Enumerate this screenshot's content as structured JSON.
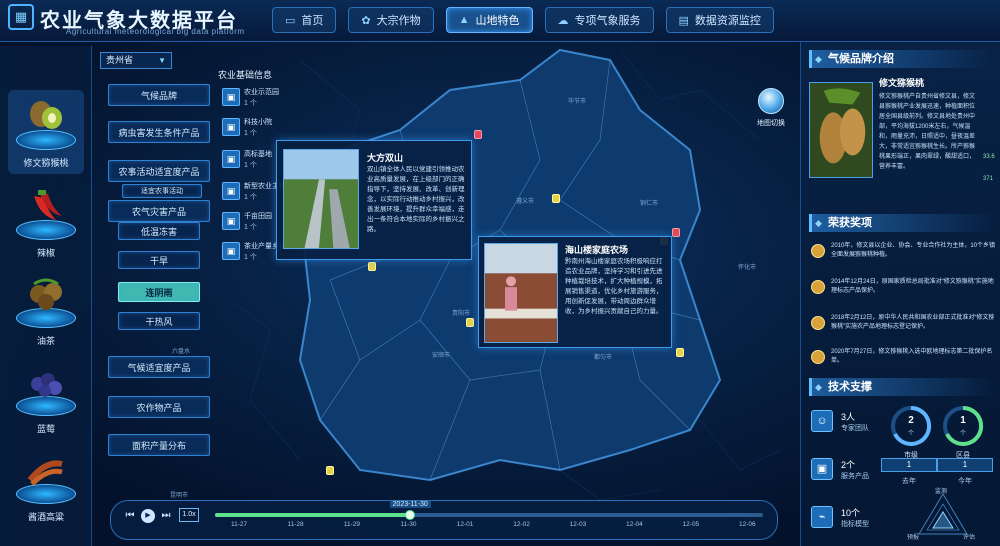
{
  "header": {
    "title": "农业气象大数据平台",
    "subtitle": "Agricultural meteorological big data platform",
    "tabs": [
      {
        "label": "首页",
        "icon": "monitor-icon"
      },
      {
        "label": "大宗作物",
        "icon": "crop-icon"
      },
      {
        "label": "山地特色",
        "icon": "mountain-icon",
        "active": true
      },
      {
        "label": "专项气象服务",
        "icon": "weather-icon"
      },
      {
        "label": "数据资源监控",
        "icon": "database-icon"
      }
    ]
  },
  "crops": [
    {
      "label": "修文猕猴桃",
      "icon": "kiwi-icon",
      "active": true
    },
    {
      "label": "辣椒",
      "icon": "chili-icon"
    },
    {
      "label": "油茶",
      "icon": "oil-tea-icon"
    },
    {
      "label": "蓝莓",
      "icon": "blueberry-icon"
    },
    {
      "label": "酱酒高粱",
      "icon": "sorghum-icon"
    }
  ],
  "province": {
    "selected": "贵州省"
  },
  "controls": {
    "climate_brand": "气候品牌",
    "pest_product": "病虫害发生条件产品",
    "farming_product": "农事活动适宜度产品",
    "farming_small": "适宜农事活动",
    "disaster_product": "农气灾害产品",
    "low_temp": "低温冻害",
    "drought": "干旱",
    "continuous_rain": "连阴雨",
    "dry_hot_wind": "干热风",
    "suitability_product": "气候适宜度产品",
    "yield_product": "农作物产品",
    "yield_distribution": "面积产量分布"
  },
  "info": {
    "title": "农业基础信息",
    "items": [
      {
        "name": "农业示范园",
        "count": "1 个"
      },
      {
        "name": "科技小院",
        "count": "1 个"
      },
      {
        "name": "高标基地",
        "count": "1 个"
      },
      {
        "name": "新型农业主体",
        "count": "1 个"
      },
      {
        "name": "千亩田园",
        "count": "1 个"
      },
      {
        "name": "茶业产量乡镇",
        "count": "1 个"
      }
    ]
  },
  "popups": [
    {
      "title": "大方双山",
      "text": "双山镇全体人民以党建引领推动农业高质量发展，在上级部门的正确指导下，坚持发展、改革、创新理念，以实际行动推动乡村振兴，改善发展环境，提升群众幸福感，走出一条符合本地实际的乡村振兴之路。"
    },
    {
      "title": "海山楼家庭农场",
      "text": "黔南州海山楼家庭农场积极响应打造农业品牌，坚持学习和引进先进种植栽培技术，扩大种植规模，拓展销售渠道，优化乡村旅游服务，用创新促发展，带动周边群众增收，为乡村振兴贡献自己的力量。"
    }
  ],
  "map_switch": "地图切换",
  "timeline": {
    "current": "2023-11-30",
    "progress": 0.355,
    "speed": "1.0x",
    "ticks": [
      "11-27",
      "11-28",
      "11-29",
      "11-30",
      "12-01",
      "12-02",
      "12-03",
      "12-04",
      "12-05",
      "12-06"
    ]
  },
  "right": {
    "brand_title": "气候品牌介绍",
    "brand_name": "修文猕猴桃",
    "brand_text": "修文猕猴桃产自贵州省修文县，修文县猕猴桃产业发展迅速，种植面积位居全国县级前列。修文县地处贵州中部，平均海拔1200米左右，气候温和，雨量充沛，日照适中，昼夜温差大，非常适宜猕猴桃生长。所产猕猴桃果形端正，果肉翠绿，酸甜适口，营养丰富。",
    "brand_stats": [
      "33.6",
      "371"
    ],
    "awards_title": "荣获奖项",
    "awards": [
      "2010年，修文县以企业、协会、专业合作社为主体，10个乡镇全面发展猕猴桃种植。",
      "2014年12月24日，原国家质检总局批准对“修文猕猴桃”实施地理标志产品保护。",
      "2018年2月12日，原中华人民共和国农业部正式批准对“修文猕猴桃”实施农产品地理标志登记保护。",
      "2020年7月27日，修文猕猴桃入选中欧地理标志第二批保护名单。"
    ],
    "tech_title": "技术支撑",
    "tech_items": [
      {
        "value": "3人",
        "name": "专家团队",
        "icon": "team-icon"
      },
      {
        "value": "2个",
        "name": "服务产品",
        "icon": "product-icon"
      },
      {
        "value": "10个",
        "name": "指标模型",
        "icon": "model-icon"
      }
    ],
    "gauges": [
      {
        "value": "2",
        "unit": "个",
        "label": "市级"
      },
      {
        "value": "1",
        "unit": "个",
        "label": "区县"
      }
    ],
    "years": [
      {
        "value": "1",
        "label": "去年"
      },
      {
        "value": "1",
        "label": "今年"
      }
    ],
    "radar_labels": [
      "监测",
      "预报",
      "评估"
    ]
  },
  "colors": {
    "accent": "#3a9cff",
    "selected": "#3fb8b0",
    "progress": "#5fe08a"
  }
}
